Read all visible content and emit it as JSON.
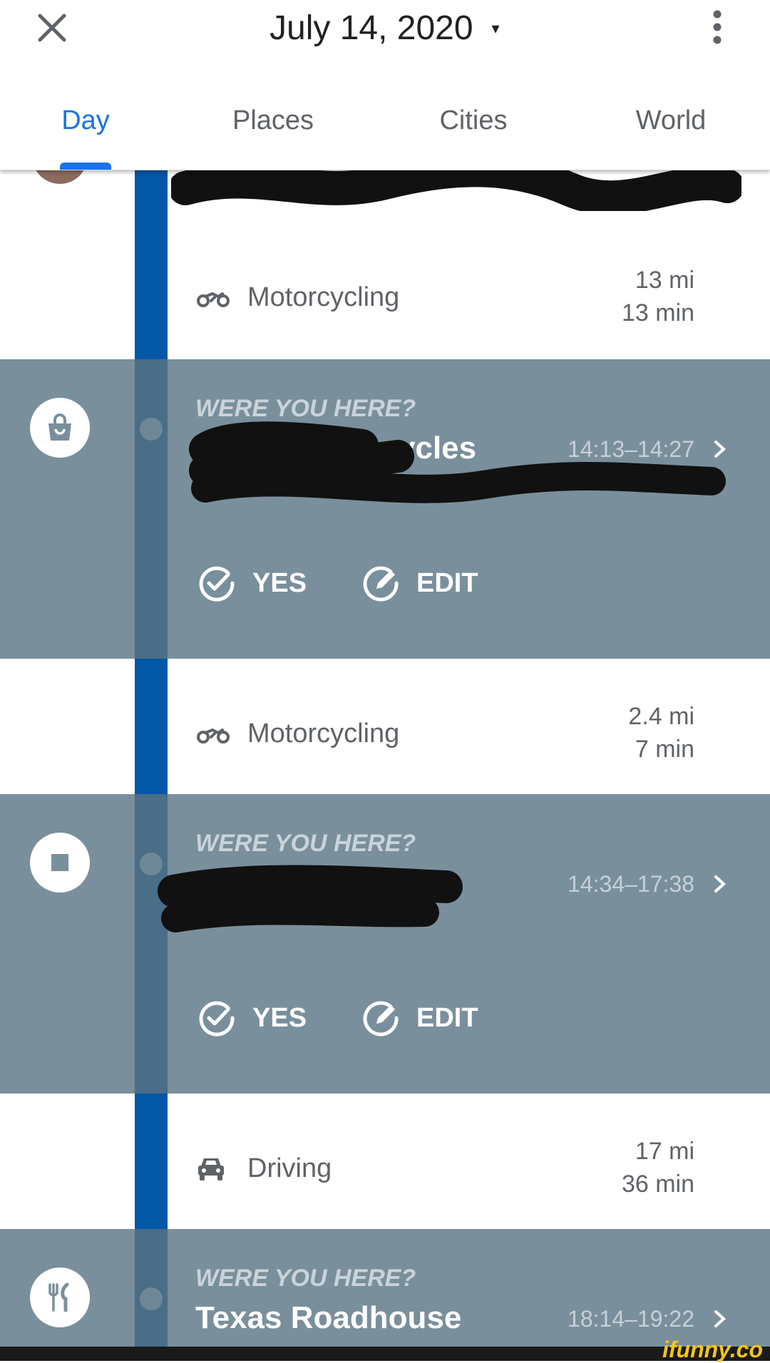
{
  "header": {
    "date": "July 14, 2020",
    "date_caret": "▾",
    "close_icon": "close-icon",
    "menu_icon": "more-vert-icon"
  },
  "tabs": [
    {
      "label": "Day",
      "active": true
    },
    {
      "label": "Places",
      "active": false
    },
    {
      "label": "Cities",
      "active": false
    },
    {
      "label": "World",
      "active": false
    }
  ],
  "timeline": [
    {
      "kind": "travel",
      "mode": "Motorcycling",
      "icon": "motorcycle-icon",
      "distance": "13 mi",
      "duration": "13 min"
    },
    {
      "kind": "visit",
      "prompt": "WERE YOU HERE?",
      "name": "ycles",
      "time": "14:13–14:27",
      "icon": "shopping-bag-icon",
      "yes": "YES",
      "edit": "EDIT"
    },
    {
      "kind": "travel",
      "mode": "Motorcycling",
      "icon": "motorcycle-icon",
      "distance": "2.4 mi",
      "duration": "7 min"
    },
    {
      "kind": "visit",
      "prompt": "WERE YOU HERE?",
      "name": "",
      "time": "14:34–17:38",
      "icon": "stop-icon",
      "yes": "YES",
      "edit": "EDIT"
    },
    {
      "kind": "travel",
      "mode": "Driving",
      "icon": "car-icon",
      "distance": "17 mi",
      "duration": "36 min"
    },
    {
      "kind": "visit",
      "prompt": "WERE YOU HERE?",
      "name": "Texas Roadhouse",
      "time": "18:14–19:22",
      "icon": "restaurant-icon"
    }
  ],
  "watermark": "ifunny.co",
  "colors": {
    "accent": "#1a73e8",
    "timeline": "#0257a6",
    "card": "#7a8f9c"
  }
}
